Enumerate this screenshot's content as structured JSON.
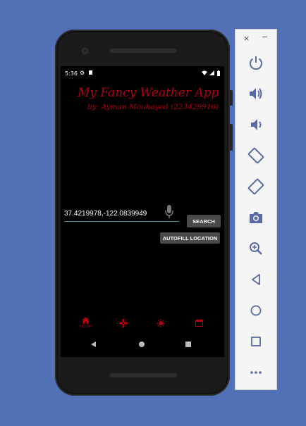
{
  "device": {
    "status_bar": {
      "time": "5:36",
      "icons_left": [
        "gear-icon",
        "sdcard-icon"
      ],
      "icons_right": [
        "wifi-icon",
        "signal-icon",
        "battery-icon"
      ]
    },
    "app": {
      "title": "My Fancy Weather App",
      "subtitle": "by: Ayman Moubayed (223429916)",
      "location_input": {
        "value": "37.4219978,-122.0839949",
        "placeholder": ""
      },
      "search_label": "SEARCH",
      "autofill_label": "AUTOFILL LOCATION",
      "bottom_nav": [
        {
          "icon": "home-icon",
          "label": "Home",
          "selected": true
        },
        {
          "icon": "gamepad-icon",
          "label": ""
        },
        {
          "icon": "sun-icon",
          "label": ""
        },
        {
          "icon": "calendar-icon",
          "label": ""
        }
      ]
    },
    "system_nav": [
      "back",
      "home",
      "recents"
    ]
  },
  "emulator_toolbar": {
    "close_glyph": "×",
    "minimize_glyph": "−",
    "buttons": [
      "power-icon",
      "volume-up-icon",
      "volume-down-icon",
      "rotate-left-icon",
      "rotate-right-icon",
      "camera-icon",
      "zoom-icon",
      "back-icon",
      "home-icon",
      "overview-icon",
      "more-icon"
    ]
  },
  "colors": {
    "background": "#5170b5",
    "accent": "#b00010",
    "input_underline": "#3e8a8f",
    "button": "#4a4a4a"
  }
}
